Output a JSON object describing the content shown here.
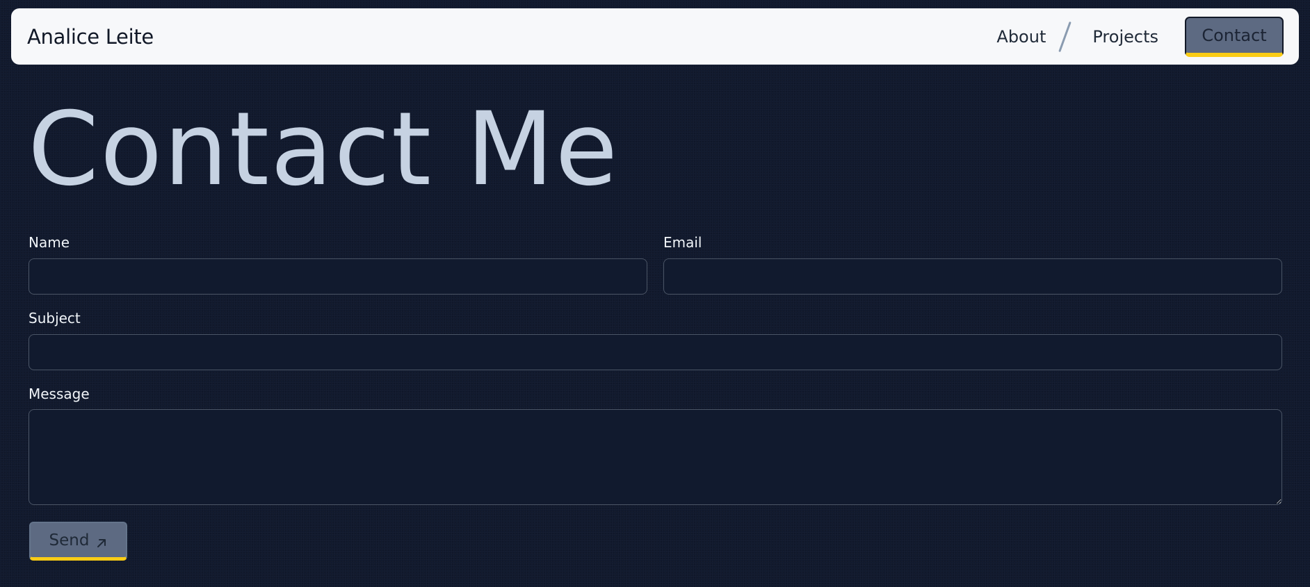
{
  "header": {
    "brand": "Analice Leite",
    "nav": {
      "about": "About",
      "projects": "Projects",
      "contact": "Contact"
    }
  },
  "main": {
    "title": "Contact Me",
    "form": {
      "name_label": "Name",
      "name_value": "",
      "email_label": "Email",
      "email_value": "",
      "subject_label": "Subject",
      "subject_value": "",
      "message_label": "Message",
      "message_value": "",
      "send_label": "Send",
      "send_icon": "arrow-up-right-icon"
    }
  },
  "colors": {
    "background": "#111a2e",
    "navbar": "#f7f8fa",
    "button": "#5d6a82",
    "accent": "#facc15",
    "title": "#c6d2e2"
  }
}
